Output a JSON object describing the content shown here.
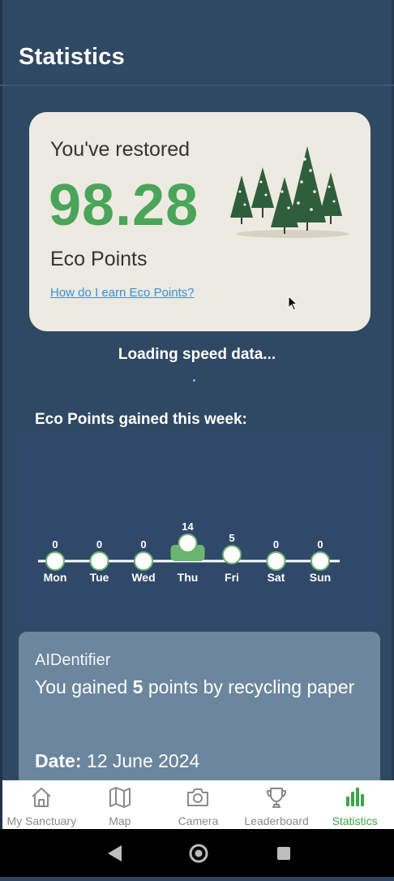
{
  "header": {
    "title": "Statistics"
  },
  "eco_card": {
    "restored_label": "You've restored",
    "points": "98.28",
    "unit_label": "Eco Points",
    "earn_link": "How do I earn Eco Points?"
  },
  "loading": {
    "text": "Loading speed data..."
  },
  "week": {
    "title": "Eco Points gained this week:",
    "days": [
      {
        "day": "Mon",
        "value": 0
      },
      {
        "day": "Tue",
        "value": 0
      },
      {
        "day": "Wed",
        "value": 0
      },
      {
        "day": "Thu",
        "value": 14
      },
      {
        "day": "Fri",
        "value": 5
      },
      {
        "day": "Sat",
        "value": 0
      },
      {
        "day": "Sun",
        "value": 0
      }
    ],
    "colors": {
      "bar": "#6cb36f",
      "line": "#ffffff",
      "marker": "#ffffff"
    }
  },
  "activity": {
    "source": "AIDentifier",
    "message_prefix": "You gained",
    "message_points": "5",
    "message_suffix": "points by recycling paper",
    "date_label": "Date:",
    "date_value": "12 June 2024"
  },
  "nav": {
    "items": [
      {
        "label": "My Sanctuary",
        "icon": "house-icon"
      },
      {
        "label": "Map",
        "icon": "map-icon"
      },
      {
        "label": "Camera",
        "icon": "camera-icon"
      },
      {
        "label": "Leaderboard",
        "icon": "trophy-icon"
      },
      {
        "label": "Statistics",
        "icon": "bar-chart-icon"
      }
    ],
    "active_color": "#3fa54a",
    "inactive_color": "#8a8a8a"
  }
}
